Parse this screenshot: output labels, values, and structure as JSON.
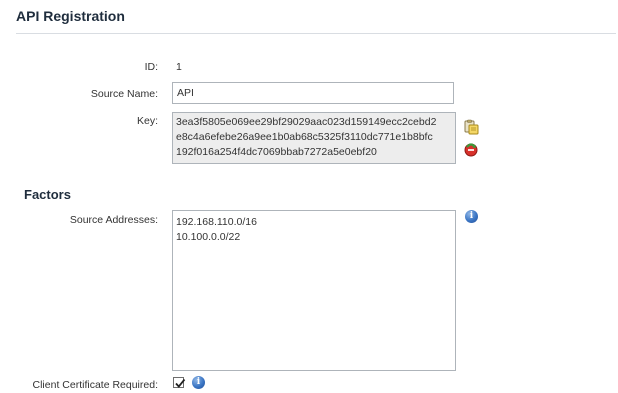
{
  "header": {
    "title": "API Registration"
  },
  "form": {
    "id_label": "ID:",
    "id_value": "1",
    "source_name_label": "Source Name:",
    "source_name_value": "API",
    "key_label": "Key:",
    "key_lines": [
      "3ea3f5805e069ee29bf29029aac023d159149ecc2cebd2",
      "e8c4a6efebe26a9ee1b0ab68c5325f3110dc771e1b8bfc",
      "192f016a254f4dc7069bbab7272a5e0ebf20"
    ],
    "icons": {
      "copy_key": "copy-key-icon",
      "regenerate_key": "regenerate-key-icon"
    }
  },
  "factors": {
    "title": "Factors",
    "source_addresses_label": "Source Addresses:",
    "source_addresses": [
      "192.168.110.0/16",
      "10.100.0.0/22"
    ],
    "client_cert_label": "Client Certificate Required:",
    "client_cert_checked": true,
    "info_glyph": "i"
  },
  "colors": {
    "info_blue": "#3a75c4",
    "field_border": "#aeb4ba",
    "readonly_bg": "#ededed"
  }
}
